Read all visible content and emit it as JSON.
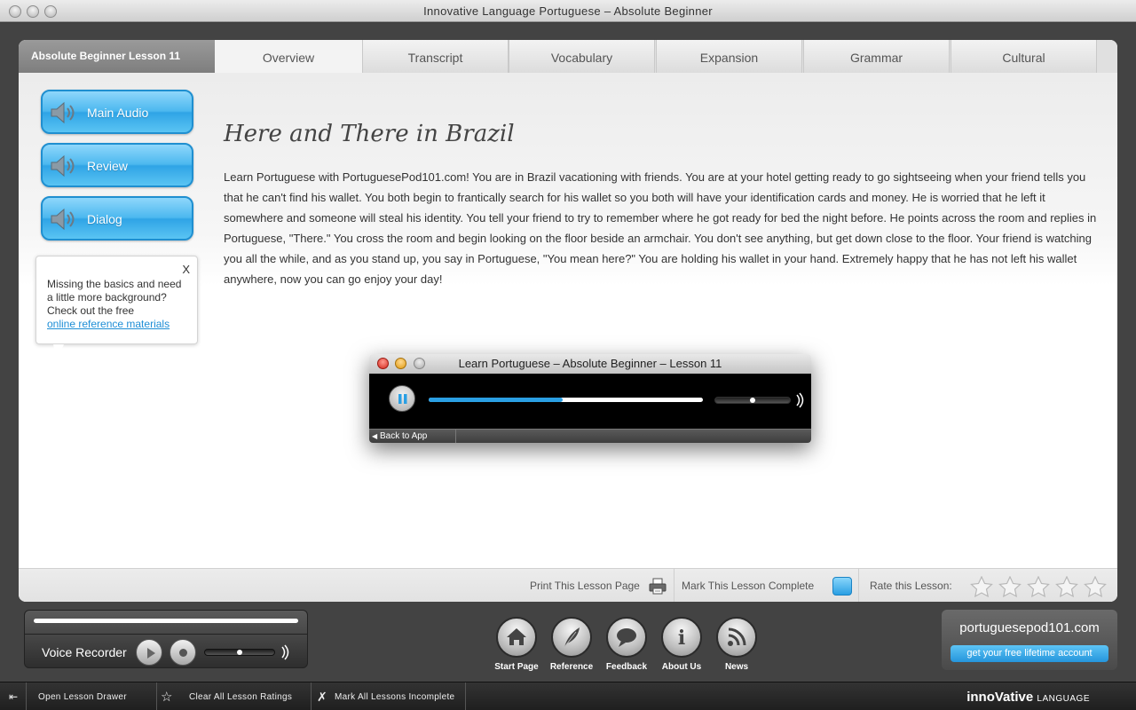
{
  "window": {
    "title": "Innovative Language Portuguese – Absolute Beginner"
  },
  "lesson_label": "Absolute Beginner Lesson 11",
  "tabs": [
    {
      "label": "Overview",
      "active": true
    },
    {
      "label": "Transcript"
    },
    {
      "label": "Vocabulary"
    },
    {
      "label": "Expansion"
    },
    {
      "label": "Grammar"
    },
    {
      "label": "Cultural"
    }
  ],
  "side_buttons": [
    {
      "label": "Main Audio",
      "icon": "speaker-icon"
    },
    {
      "label": "Review",
      "icon": "speaker-icon"
    },
    {
      "label": "Dialog",
      "icon": "speaker-icon"
    }
  ],
  "tip": {
    "close": "X",
    "text": "Missing the basics and need a little more background? Check out the free",
    "link": "online reference materials"
  },
  "article": {
    "title": "Here and There in Brazil",
    "body": "Learn Portuguese with PortuguesePod101.com! You are in Brazil vacationing with friends. You are at your hotel getting ready to go sightseeing when your friend tells you that he can't find his wallet. You both begin to frantically search for his wallet so you both will have your identification cards and money. He is worried that he left it somewhere and someone will steal his identity. You tell your friend to try to remember where he got ready for bed the night before. He points across the room and replies in Portuguese, \"There.\" You cross the room and begin looking on the floor beside an armchair. You don't see anything, but get down close to the floor. Your friend is watching you all the while, and as you stand up, you say in Portuguese, \"You mean here?\" You are holding his wallet in your hand. Extremely happy that he has not left his wallet anywhere, now you can go enjoy your day!"
  },
  "panel_footer": {
    "print": "Print This Lesson Page",
    "mark_complete": "Mark This Lesson Complete",
    "rate": "Rate this Lesson:",
    "stars": 5
  },
  "player": {
    "title": "Learn Portuguese – Absolute Beginner – Lesson 11",
    "back": "Back to App",
    "progress": 0.49,
    "volume": 0.5
  },
  "recorder": {
    "label": "Voice Recorder",
    "volume": 0.5
  },
  "nav": [
    {
      "label": "Start Page",
      "icon": "home-icon"
    },
    {
      "label": "Reference",
      "icon": "feather-icon"
    },
    {
      "label": "Feedback",
      "icon": "speech-bubble-icon"
    },
    {
      "label": "About Us",
      "icon": "info-icon"
    },
    {
      "label": "News",
      "icon": "rss-icon"
    }
  ],
  "promo": {
    "title": "portuguesepod101.com",
    "button": "get your free lifetime account"
  },
  "statusbar": {
    "open_drawer": "Open Lesson Drawer",
    "clear_ratings": "Clear All Lesson Ratings",
    "mark_incomplete": "Mark All Lessons Incomplete",
    "brand_main": "innoVative",
    "brand_sub": "LANGUAGE"
  }
}
